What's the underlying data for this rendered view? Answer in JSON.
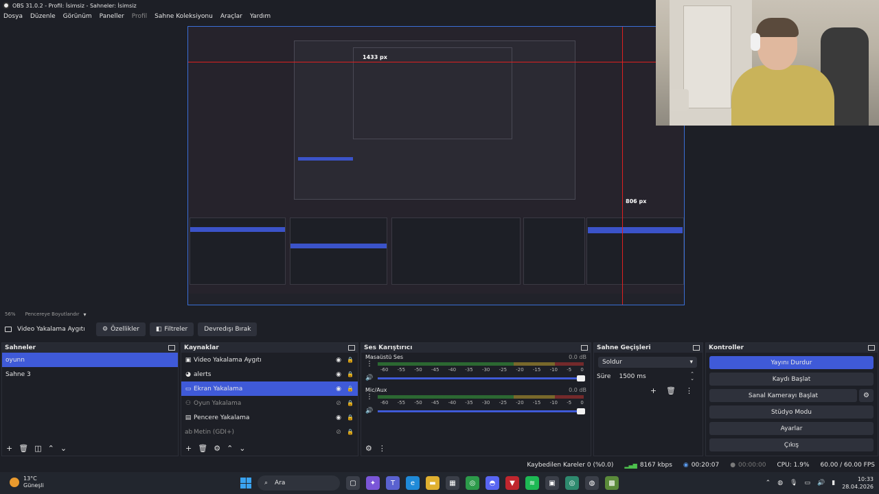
{
  "window": {
    "title": "OBS 31.0.2 - Profil: İsimsiz - Sahneler: İsimsiz"
  },
  "menu": [
    "Dosya",
    "Düzenle",
    "Görünüm",
    "Paneller",
    "Profil",
    "Sahne Koleksiyonu",
    "Araçlar",
    "Yardım"
  ],
  "menu_disabled_index": 4,
  "preview": {
    "width_label": "1433 px",
    "height_label": "806 px",
    "scale_text": "56%",
    "scale_mode": "Pencereye Boyutlandır"
  },
  "source_toolbar": {
    "current_source": "Video Yakalama Aygıtı",
    "properties": "Özellikler",
    "filters": "Filtreler",
    "deactivate": "Devredışı Bırak"
  },
  "scenes": {
    "title": "Sahneler",
    "items": [
      {
        "label": "oyunn",
        "selected": true
      },
      {
        "label": "Sahne 3",
        "selected": false
      }
    ]
  },
  "sources": {
    "title": "Kaynaklar",
    "items": [
      {
        "label": "Video Yakalama Aygıtı",
        "icon": "camera-icon",
        "visible": true,
        "dim": false,
        "selected": false
      },
      {
        "label": "alerts",
        "icon": "globe-icon",
        "visible": true,
        "dim": false,
        "selected": false
      },
      {
        "label": "Ekran Yakalama",
        "icon": "monitor-icon",
        "visible": true,
        "dim": false,
        "selected": true
      },
      {
        "label": "Oyun Yakalama",
        "icon": "gamepad-icon",
        "visible": false,
        "dim": true,
        "selected": false
      },
      {
        "label": "Pencere Yakalama",
        "icon": "window-icon",
        "visible": true,
        "dim": false,
        "selected": false
      },
      {
        "label": "Metin (GDI+)",
        "icon": "text-icon",
        "visible": false,
        "dim": true,
        "selected": false
      }
    ]
  },
  "mixer": {
    "title": "Ses Karıştırıcı",
    "channels": [
      {
        "name": "Masaüstü Ses",
        "db": "0.0 dB"
      },
      {
        "name": "Mic/Aux",
        "db": "0.0 dB"
      }
    ],
    "ticks": [
      "-60",
      "-55",
      "-50",
      "-45",
      "-40",
      "-35",
      "-30",
      "-25",
      "-20",
      "-15",
      "-10",
      "-5",
      "0"
    ]
  },
  "transitions": {
    "title": "Sahne Geçişleri",
    "selected": "Soldur",
    "duration_label": "Süre",
    "duration_value": "1500 ms"
  },
  "controls": {
    "title": "Kontroller",
    "stop_stream": "Yayını Durdur",
    "start_record": "Kaydı Başlat",
    "start_virtualcam": "Sanal Kamerayı Başlat",
    "studio_mode": "Stüdyo Modu",
    "settings": "Ayarlar",
    "exit": "Çıkış"
  },
  "status": {
    "dropped_frames": "Kaybedilen Kareler 0 (%0.0)",
    "bitrate": "8167 kbps",
    "stream_time": "00:20:07",
    "rec_time": "00:00:00",
    "cpu": "CPU: 1.9%",
    "fps": "60.00 / 60.00 FPS"
  },
  "taskbar": {
    "weather_temp": "13°C",
    "weather_desc": "Güneşli",
    "search": "Ara",
    "time": "10:33",
    "date": "28.04.2026"
  },
  "colors": {
    "accent": "#3f5ad8",
    "background": "#1d1f26",
    "button": "#2e313b",
    "live_red": "#e02020"
  }
}
